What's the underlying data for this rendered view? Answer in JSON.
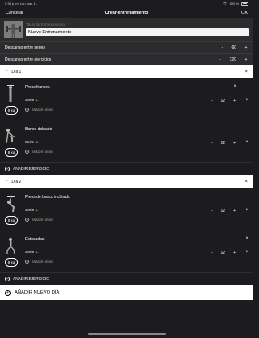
{
  "status_bar": {
    "time": "5:38 p. m.",
    "date": "Lun mar. 11",
    "battery": "100 %"
  },
  "nav": {
    "cancel": "Cancelar",
    "title": "Crear entrenamiento",
    "ok": "OK"
  },
  "plan": {
    "name_label": "Título de Entrenamiento",
    "name_value": "Nuevo Entrenamiento"
  },
  "rest": [
    {
      "label": "Descanso entre series",
      "minus": "-",
      "value": "60",
      "plus": "+"
    },
    {
      "label": "Descanso entre ejercicios",
      "minus": "-",
      "value": "120",
      "plus": "+"
    }
  ],
  "days": [
    {
      "title": "Día 1",
      "chevron": "^",
      "close": "×",
      "exercises": [
        {
          "name": "Press frances",
          "serie": "Serie 1:",
          "minus": "-",
          "reps": "12",
          "plus": "+",
          "weight": "8 kg",
          "add_serie": "AÑADIR SERIE",
          "close": "×"
        },
        {
          "name": "Banco doblado",
          "serie": "Serie 1:",
          "minus": "-",
          "reps": "12",
          "plus": "+",
          "weight": "8 kg",
          "add_serie": "AÑADIR SERIE",
          "close": "×"
        }
      ],
      "add_exercise": "AÑADIR EJERCICIO"
    },
    {
      "title": "Día 2",
      "chevron": "^",
      "close": "×",
      "exercises": [
        {
          "name": "Press de banco inclinado",
          "serie": "Serie 1:",
          "minus": "-",
          "reps": "12",
          "plus": "+",
          "weight": "8 kg",
          "add_serie": "AÑADIR SERIE",
          "close": "×"
        },
        {
          "name": "Estocadas",
          "serie": "Serie 1:",
          "minus": "-",
          "reps": "12",
          "plus": "+",
          "weight": "8 kg",
          "add_serie": "AÑADIR SERIE",
          "close": "×"
        }
      ],
      "add_exercise": "AÑADIR EJERCICIO"
    }
  ],
  "add_day": "AÑADIR NUEVO DÍA",
  "icons": {
    "plus": "+"
  }
}
